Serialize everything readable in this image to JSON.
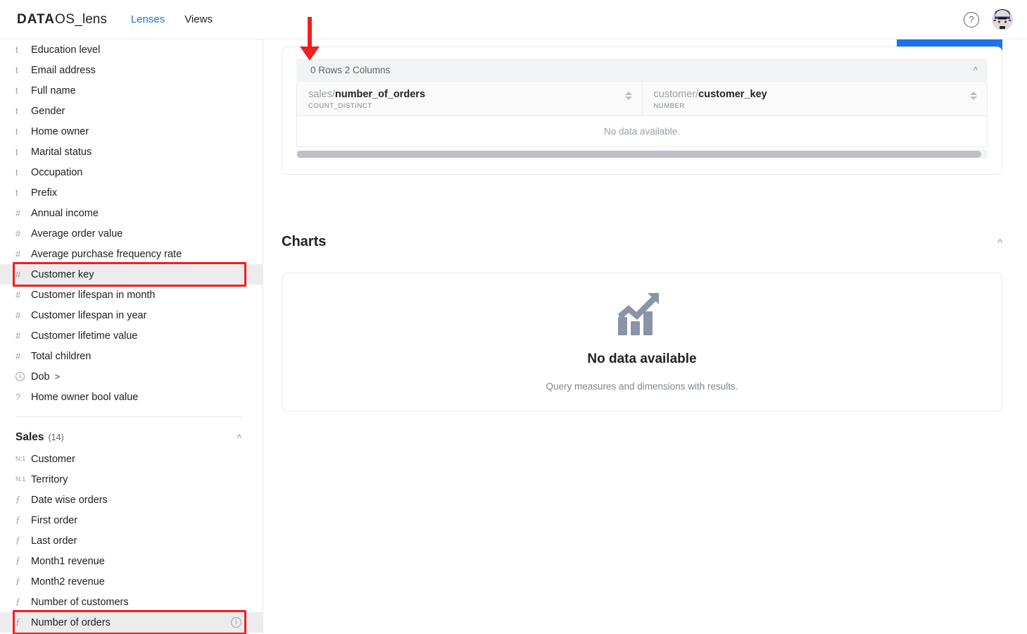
{
  "app": {
    "logo_data": "DATA",
    "logo_os": "OS",
    "logo_lens": "_lens"
  },
  "topnav": {
    "links": [
      {
        "label": "Lenses",
        "active": true
      },
      {
        "label": "Views",
        "active": false
      }
    ],
    "help_icon": "help-question-icon",
    "help_glyph": "?",
    "avatar": "user-avatar"
  },
  "sidebar": {
    "fields": [
      {
        "icon": "t",
        "label": "Education level"
      },
      {
        "icon": "t",
        "label": "Email address"
      },
      {
        "icon": "t",
        "label": "Full name"
      },
      {
        "icon": "t",
        "label": "Gender"
      },
      {
        "icon": "t",
        "label": "Home owner"
      },
      {
        "icon": "t",
        "label": "Marital status"
      },
      {
        "icon": "t",
        "label": "Occupation"
      },
      {
        "icon": "t",
        "label": "Prefix"
      },
      {
        "icon": "#",
        "label": "Annual income"
      },
      {
        "icon": "#",
        "label": "Average order value"
      },
      {
        "icon": "#",
        "label": "Average purchase frequency rate"
      },
      {
        "icon": "#",
        "label": "Customer key",
        "selected": true,
        "annotated": true
      },
      {
        "icon": "#",
        "label": "Customer lifespan in month"
      },
      {
        "icon": "#",
        "label": "Customer lifespan in year"
      },
      {
        "icon": "#",
        "label": "Customer lifetime value"
      },
      {
        "icon": "#",
        "label": "Total children"
      },
      {
        "icon": "clock",
        "label": "Dob",
        "chevron": ">"
      },
      {
        "icon": "?",
        "label": "Home owner bool value"
      }
    ],
    "group": {
      "title": "Sales",
      "count": "(14)",
      "chevron": "collapse-chevron-up-icon",
      "items": [
        {
          "icon": "N:1",
          "label": "Customer"
        },
        {
          "icon": "N:1",
          "label": "Territory"
        },
        {
          "icon": "f",
          "label": "Date wise orders"
        },
        {
          "icon": "f",
          "label": "First order"
        },
        {
          "icon": "f",
          "label": "Last order"
        },
        {
          "icon": "f",
          "label": "Month1 revenue"
        },
        {
          "icon": "f",
          "label": "Month2 revenue"
        },
        {
          "icon": "f",
          "label": "Number of customers"
        },
        {
          "icon": "f",
          "label": "Number of orders",
          "selected": true,
          "annotated": true,
          "info": true
        }
      ]
    }
  },
  "main": {
    "results": {
      "summary": "0 Rows 2 Columns",
      "collapse_chevron": "chevron-up-icon",
      "columns": [
        {
          "namespace": "sales/",
          "name": "number_of_orders",
          "type": "COUNT_DISTINCT"
        },
        {
          "namespace": "customer/",
          "name": "customer_key",
          "type": "NUMBER"
        }
      ],
      "empty_row_text": "No data available."
    },
    "charts": {
      "title": "Charts",
      "collapse_chevron": "chevron-up-icon",
      "empty_title": "No data available",
      "empty_subtitle": "Query measures and dimensions with results.",
      "empty_icon": "bar-chart-trend-icon"
    },
    "primary_button": "primary-action-button"
  },
  "annotations": {
    "arrow_color": "#f01f23",
    "box_color": "#f01f23"
  },
  "colors": {
    "accent_blue": "#1a73e8",
    "selected_row": "#ececec",
    "annotation_red": "#f01f23"
  }
}
